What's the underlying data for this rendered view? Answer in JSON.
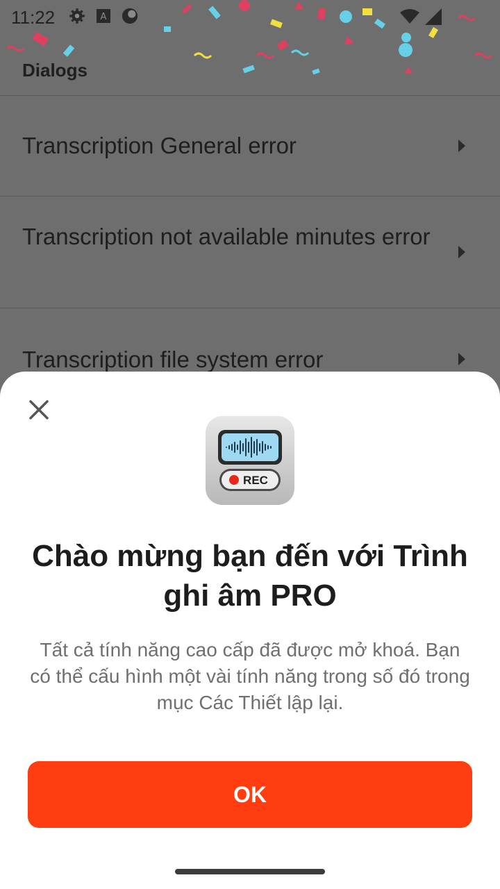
{
  "status_bar": {
    "time": "11:22",
    "icons": [
      "settings-icon",
      "font-a-icon",
      "app-circle-icon"
    ],
    "right_icons": [
      "wifi-icon",
      "cell-signal-icon"
    ]
  },
  "list": {
    "section_header": "Dialogs",
    "items": [
      {
        "label": "Transcription General error"
      },
      {
        "label": "Transcription not available minutes error"
      },
      {
        "label": "Transcription file system error"
      }
    ]
  },
  "dialog": {
    "app_icon_label": "REC",
    "title": "Chào mừng bạn đến với Trình ghi âm PRO",
    "body": "Tất cả tính năng cao cấp đã được mở khoá. Bạn có thể cấu hình một vài tính năng trong số đó trong mục Các Thiết lập lại.",
    "ok_label": "OK"
  },
  "colors": {
    "accent": "#ff3d10",
    "scrim": "#6e6e6e",
    "rec_dot": "#e8261a"
  }
}
